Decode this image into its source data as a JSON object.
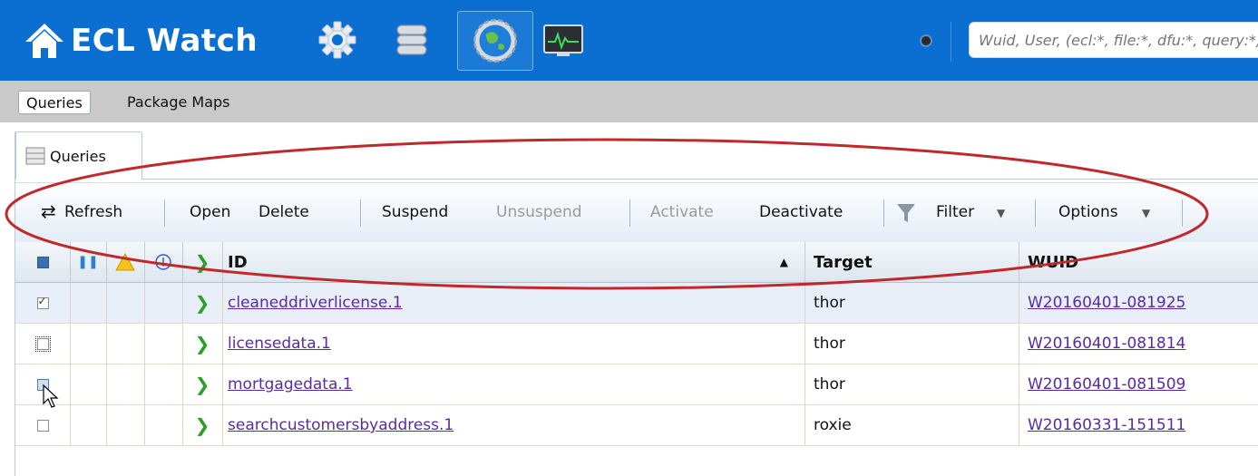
{
  "header": {
    "app_title": "ECL Watch",
    "search_placeholder": "Wuid, User, (ecl:*, file:*, dfu:*, query:*)...",
    "icons": [
      "home-icon",
      "gear-icon",
      "database-icon",
      "globe-gear-icon",
      "activity-monitor-icon"
    ]
  },
  "subnav": {
    "items": [
      {
        "label": "Queries",
        "active": true
      },
      {
        "label": "Package Maps",
        "active": false
      }
    ]
  },
  "panel_tab": {
    "label": "Queries"
  },
  "toolbar": {
    "refresh": "Refresh",
    "open": "Open",
    "delete": "Delete",
    "suspend": "Suspend",
    "unsuspend": "Unsuspend",
    "activate": "Activate",
    "deactivate": "Deactivate",
    "filter": "Filter",
    "options": "Options"
  },
  "grid": {
    "columns": {
      "id": "ID",
      "target": "Target",
      "wuid": "WUID"
    },
    "rows": [
      {
        "id": "cleaneddriverlicense.1",
        "target": "thor",
        "wuid": "W20160401-081925",
        "checked": true,
        "selected": true
      },
      {
        "id": "licensedata.1",
        "target": "thor",
        "wuid": "W20160401-081814",
        "checked": false,
        "selected": false
      },
      {
        "id": "mortgagedata.1",
        "target": "thor",
        "wuid": "W20160401-081509",
        "checked": false,
        "selected": false
      },
      {
        "id": "searchcustomersbyaddress.1",
        "target": "roxie",
        "wuid": "W20160331-151511",
        "checked": false,
        "selected": false
      }
    ]
  },
  "colors": {
    "header_bg": "#0b6ed1",
    "annotation_ellipse": "#c0282a",
    "link": "#5b2aa1"
  }
}
